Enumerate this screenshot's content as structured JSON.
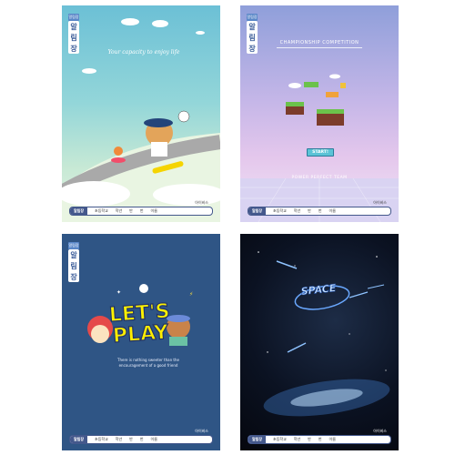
{
  "covers": [
    {
      "id": "sky",
      "subject_tag": "알림장",
      "subject_chars": [
        "알",
        "림",
        "장"
      ],
      "tagline": "Your capacity to enjoy life",
      "brand": "아이비스",
      "namebar": {
        "label": "알림장",
        "school": "초등학교",
        "grade": "학년",
        "class": "반",
        "number": "번",
        "name": "이름"
      }
    },
    {
      "id": "game",
      "subject_tag": "알림장",
      "subject_chars": [
        "알",
        "림",
        "장"
      ],
      "headline": "CHAMPIONSHIP COMPETITION",
      "start": "START!",
      "team": "POWER PERFECT TEAM",
      "brand": "아이비스",
      "namebar": {
        "label": "알림장",
        "school": "초등학교",
        "grade": "학년",
        "class": "반",
        "number": "번",
        "name": "이름"
      }
    },
    {
      "id": "play",
      "subject_tag": "알림장",
      "subject_chars": [
        "알",
        "림",
        "장"
      ],
      "title_line1": "LET'S",
      "title_line2": "PLAY",
      "quote": "There is nothing sweeter than the encouragement of a good friend",
      "brand": "아이비스",
      "namebar": {
        "label": "알림장",
        "school": "초등학교",
        "grade": "학년",
        "class": "반",
        "number": "번",
        "name": "이름"
      }
    },
    {
      "id": "space",
      "logo": "SPACE",
      "brand": "아이비스",
      "namebar": {
        "label": "알림장",
        "school": "초등학교",
        "grade": "학년",
        "class": "반",
        "number": "번",
        "name": "이름"
      }
    }
  ],
  "colors": {
    "navy": "#44588c",
    "play_bg": "#2f5585",
    "space_bg": "#0b1222"
  }
}
